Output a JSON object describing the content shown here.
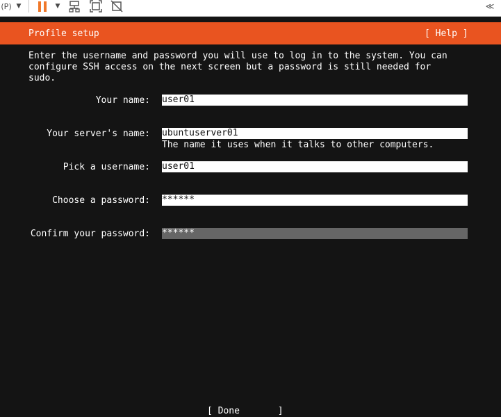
{
  "toolbar": {
    "p_label": "(P)",
    "collapse_label": "≪"
  },
  "header": {
    "title": "Profile setup",
    "help": "[ Help ]",
    "accent_color": "#e95420"
  },
  "intro": "Enter the username and password you will use to log in to the system. You can\nconfigure SSH access on the next screen but a password is still needed for\nsudo.",
  "form": {
    "your_name": {
      "label": "Your name:",
      "value": "user01"
    },
    "server_name": {
      "label": "Your server's name:",
      "value": "ubuntuserver01",
      "hint": "The name it uses when it talks to other computers."
    },
    "username": {
      "label": "Pick a username:",
      "value": "user01"
    },
    "password": {
      "label": "Choose a password:",
      "value": "******"
    },
    "confirm_password": {
      "label": "Confirm your password:",
      "value": "******"
    }
  },
  "done_button": "[ Done       ]"
}
